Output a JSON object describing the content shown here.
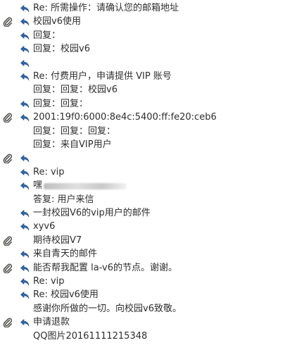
{
  "messages": [
    {
      "text": "Re: 所需操作：请确认您的邮箱地址",
      "attach": false,
      "reply": true
    },
    {
      "text": "校园v6使用",
      "attach": true,
      "reply": true
    },
    {
      "text": "回复：",
      "attach": false,
      "reply": true
    },
    {
      "text": "回复：校园v6",
      "attach": false,
      "reply": true
    },
    {
      "text": "",
      "attach": false,
      "reply": true
    },
    {
      "text": "Re: 付费用户，申请提供 VIP 账号",
      "attach": false,
      "reply": true
    },
    {
      "text": "回复：回复：校园v6",
      "attach": false,
      "reply": false
    },
    {
      "text": "回复：回复：",
      "attach": false,
      "reply": true
    },
    {
      "text": "2001:19f0:6000:8e4c:5400:ff:fe20:ceb6",
      "attach": true,
      "reply": true
    },
    {
      "text": "回复：回复：回复：",
      "attach": false,
      "reply": false
    },
    {
      "text": "回复：来自VIP用户",
      "attach": false,
      "reply": false
    },
    {
      "text": "",
      "attach": true,
      "reply": true
    },
    {
      "text": "Re: vip",
      "attach": false,
      "reply": true
    },
    {
      "text": "嘿",
      "attach": false,
      "reply": true,
      "blurred": true
    },
    {
      "text": "答复: 用户来信",
      "attach": false,
      "reply": false
    },
    {
      "text": "一封校园V6的vip用户的邮件",
      "attach": false,
      "reply": true
    },
    {
      "text": "xyv6",
      "attach": false,
      "reply": true
    },
    {
      "text": "期待校园V7",
      "attach": true,
      "reply": false
    },
    {
      "text": "来自青天的邮件",
      "attach": false,
      "reply": true
    },
    {
      "text": "能否帮我配置 la-v6的节点。谢谢。",
      "attach": true,
      "reply": true
    },
    {
      "text": "Re: vip",
      "attach": false,
      "reply": true
    },
    {
      "text": "Re: 校园v6使用",
      "attach": false,
      "reply": true
    },
    {
      "text": "感谢你所做的一切。向校园v6致敬。",
      "attach": false,
      "reply": false
    },
    {
      "text": "申请退款",
      "attach": true,
      "reply": true
    },
    {
      "text": "QQ图片20161111215348",
      "attach": false,
      "reply": false
    }
  ],
  "colors": {
    "text": "#2e2e2e",
    "reply_icon": "#3465a4",
    "clip_icon": "#555753"
  },
  "icons": {
    "reply": "reply-arrow-icon",
    "attach": "paperclip-icon"
  }
}
